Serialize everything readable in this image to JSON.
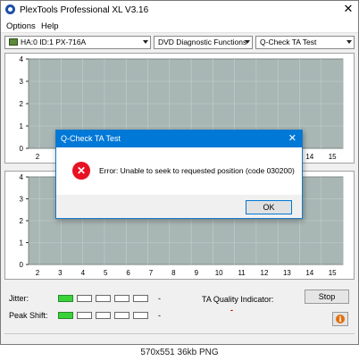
{
  "window": {
    "title": "PlexTools Professional XL V3.16",
    "close_glyph": "✕"
  },
  "menu": {
    "items": [
      "Options",
      "Help"
    ]
  },
  "toolbar": {
    "drive": "HA:0 ID:1  PX-716A",
    "function": "DVD Diagnostic Functions",
    "test": "Q-Check  TA Test"
  },
  "charts": {
    "top": {
      "y_ticks": [
        "4",
        "3",
        "2",
        "1",
        "0"
      ],
      "x_ticks": [
        "2",
        "14",
        "15"
      ],
      "ylim": [
        0,
        4
      ],
      "grid": true
    },
    "bottom": {
      "y_ticks": [
        "4",
        "3",
        "2",
        "1",
        "0"
      ],
      "x_ticks": [
        "2",
        "3",
        "4",
        "5",
        "6",
        "7",
        "8",
        "9",
        "10",
        "11",
        "12",
        "13",
        "14",
        "15"
      ],
      "ylim": [
        0,
        4
      ],
      "grid": true
    },
    "plot_color": "#a8b6b4"
  },
  "status": {
    "jitter_label": "Jitter:",
    "peak_label": "Peak Shift:",
    "jitter_dash": "-",
    "peak_dash": "-",
    "led_count": 5,
    "jitter_level_leds": 1,
    "peak_level_leds": 1,
    "ta_label": "TA Quality Indicator:",
    "ta_value": "-",
    "stop_label": "Stop",
    "info_glyph": "i"
  },
  "dialog": {
    "title": "Q-Check TA Test",
    "message": "Error: Unable to seek to requested position (code 030200)",
    "ok_label": "OK",
    "close_glyph": "✕",
    "error_glyph": "✕"
  },
  "caption": "570x551 36kb PNG"
}
